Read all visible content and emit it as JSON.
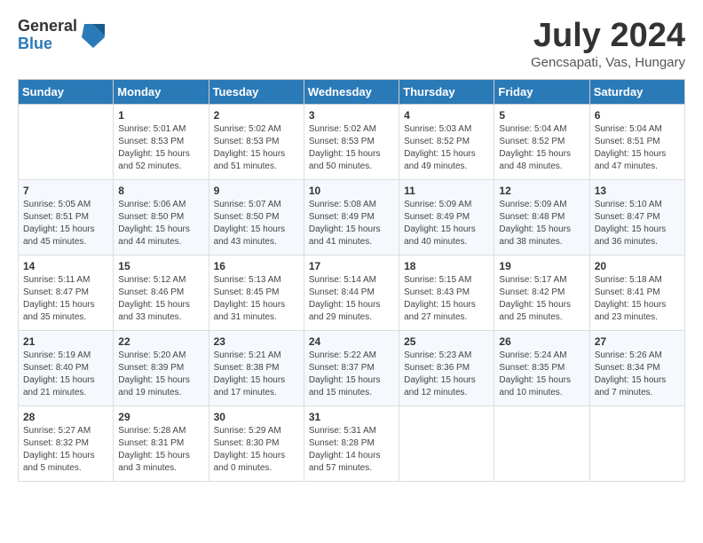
{
  "logo": {
    "general": "General",
    "blue": "Blue"
  },
  "title": "July 2024",
  "location": "Gencsapati, Vas, Hungary",
  "days": [
    "Sunday",
    "Monday",
    "Tuesday",
    "Wednesday",
    "Thursday",
    "Friday",
    "Saturday"
  ],
  "weeks": [
    [
      {
        "num": "",
        "sunrise": "",
        "sunset": "",
        "daylight": ""
      },
      {
        "num": "1",
        "sunrise": "Sunrise: 5:01 AM",
        "sunset": "Sunset: 8:53 PM",
        "daylight": "Daylight: 15 hours and 52 minutes."
      },
      {
        "num": "2",
        "sunrise": "Sunrise: 5:02 AM",
        "sunset": "Sunset: 8:53 PM",
        "daylight": "Daylight: 15 hours and 51 minutes."
      },
      {
        "num": "3",
        "sunrise": "Sunrise: 5:02 AM",
        "sunset": "Sunset: 8:53 PM",
        "daylight": "Daylight: 15 hours and 50 minutes."
      },
      {
        "num": "4",
        "sunrise": "Sunrise: 5:03 AM",
        "sunset": "Sunset: 8:52 PM",
        "daylight": "Daylight: 15 hours and 49 minutes."
      },
      {
        "num": "5",
        "sunrise": "Sunrise: 5:04 AM",
        "sunset": "Sunset: 8:52 PM",
        "daylight": "Daylight: 15 hours and 48 minutes."
      },
      {
        "num": "6",
        "sunrise": "Sunrise: 5:04 AM",
        "sunset": "Sunset: 8:51 PM",
        "daylight": "Daylight: 15 hours and 47 minutes."
      }
    ],
    [
      {
        "num": "7",
        "sunrise": "Sunrise: 5:05 AM",
        "sunset": "Sunset: 8:51 PM",
        "daylight": "Daylight: 15 hours and 45 minutes."
      },
      {
        "num": "8",
        "sunrise": "Sunrise: 5:06 AM",
        "sunset": "Sunset: 8:50 PM",
        "daylight": "Daylight: 15 hours and 44 minutes."
      },
      {
        "num": "9",
        "sunrise": "Sunrise: 5:07 AM",
        "sunset": "Sunset: 8:50 PM",
        "daylight": "Daylight: 15 hours and 43 minutes."
      },
      {
        "num": "10",
        "sunrise": "Sunrise: 5:08 AM",
        "sunset": "Sunset: 8:49 PM",
        "daylight": "Daylight: 15 hours and 41 minutes."
      },
      {
        "num": "11",
        "sunrise": "Sunrise: 5:09 AM",
        "sunset": "Sunset: 8:49 PM",
        "daylight": "Daylight: 15 hours and 40 minutes."
      },
      {
        "num": "12",
        "sunrise": "Sunrise: 5:09 AM",
        "sunset": "Sunset: 8:48 PM",
        "daylight": "Daylight: 15 hours and 38 minutes."
      },
      {
        "num": "13",
        "sunrise": "Sunrise: 5:10 AM",
        "sunset": "Sunset: 8:47 PM",
        "daylight": "Daylight: 15 hours and 36 minutes."
      }
    ],
    [
      {
        "num": "14",
        "sunrise": "Sunrise: 5:11 AM",
        "sunset": "Sunset: 8:47 PM",
        "daylight": "Daylight: 15 hours and 35 minutes."
      },
      {
        "num": "15",
        "sunrise": "Sunrise: 5:12 AM",
        "sunset": "Sunset: 8:46 PM",
        "daylight": "Daylight: 15 hours and 33 minutes."
      },
      {
        "num": "16",
        "sunrise": "Sunrise: 5:13 AM",
        "sunset": "Sunset: 8:45 PM",
        "daylight": "Daylight: 15 hours and 31 minutes."
      },
      {
        "num": "17",
        "sunrise": "Sunrise: 5:14 AM",
        "sunset": "Sunset: 8:44 PM",
        "daylight": "Daylight: 15 hours and 29 minutes."
      },
      {
        "num": "18",
        "sunrise": "Sunrise: 5:15 AM",
        "sunset": "Sunset: 8:43 PM",
        "daylight": "Daylight: 15 hours and 27 minutes."
      },
      {
        "num": "19",
        "sunrise": "Sunrise: 5:17 AM",
        "sunset": "Sunset: 8:42 PM",
        "daylight": "Daylight: 15 hours and 25 minutes."
      },
      {
        "num": "20",
        "sunrise": "Sunrise: 5:18 AM",
        "sunset": "Sunset: 8:41 PM",
        "daylight": "Daylight: 15 hours and 23 minutes."
      }
    ],
    [
      {
        "num": "21",
        "sunrise": "Sunrise: 5:19 AM",
        "sunset": "Sunset: 8:40 PM",
        "daylight": "Daylight: 15 hours and 21 minutes."
      },
      {
        "num": "22",
        "sunrise": "Sunrise: 5:20 AM",
        "sunset": "Sunset: 8:39 PM",
        "daylight": "Daylight: 15 hours and 19 minutes."
      },
      {
        "num": "23",
        "sunrise": "Sunrise: 5:21 AM",
        "sunset": "Sunset: 8:38 PM",
        "daylight": "Daylight: 15 hours and 17 minutes."
      },
      {
        "num": "24",
        "sunrise": "Sunrise: 5:22 AM",
        "sunset": "Sunset: 8:37 PM",
        "daylight": "Daylight: 15 hours and 15 minutes."
      },
      {
        "num": "25",
        "sunrise": "Sunrise: 5:23 AM",
        "sunset": "Sunset: 8:36 PM",
        "daylight": "Daylight: 15 hours and 12 minutes."
      },
      {
        "num": "26",
        "sunrise": "Sunrise: 5:24 AM",
        "sunset": "Sunset: 8:35 PM",
        "daylight": "Daylight: 15 hours and 10 minutes."
      },
      {
        "num": "27",
        "sunrise": "Sunrise: 5:26 AM",
        "sunset": "Sunset: 8:34 PM",
        "daylight": "Daylight: 15 hours and 7 minutes."
      }
    ],
    [
      {
        "num": "28",
        "sunrise": "Sunrise: 5:27 AM",
        "sunset": "Sunset: 8:32 PM",
        "daylight": "Daylight: 15 hours and 5 minutes."
      },
      {
        "num": "29",
        "sunrise": "Sunrise: 5:28 AM",
        "sunset": "Sunset: 8:31 PM",
        "daylight": "Daylight: 15 hours and 3 minutes."
      },
      {
        "num": "30",
        "sunrise": "Sunrise: 5:29 AM",
        "sunset": "Sunset: 8:30 PM",
        "daylight": "Daylight: 15 hours and 0 minutes."
      },
      {
        "num": "31",
        "sunrise": "Sunrise: 5:31 AM",
        "sunset": "Sunset: 8:28 PM",
        "daylight": "Daylight: 14 hours and 57 minutes."
      },
      {
        "num": "",
        "sunrise": "",
        "sunset": "",
        "daylight": ""
      },
      {
        "num": "",
        "sunrise": "",
        "sunset": "",
        "daylight": ""
      },
      {
        "num": "",
        "sunrise": "",
        "sunset": "",
        "daylight": ""
      }
    ]
  ]
}
